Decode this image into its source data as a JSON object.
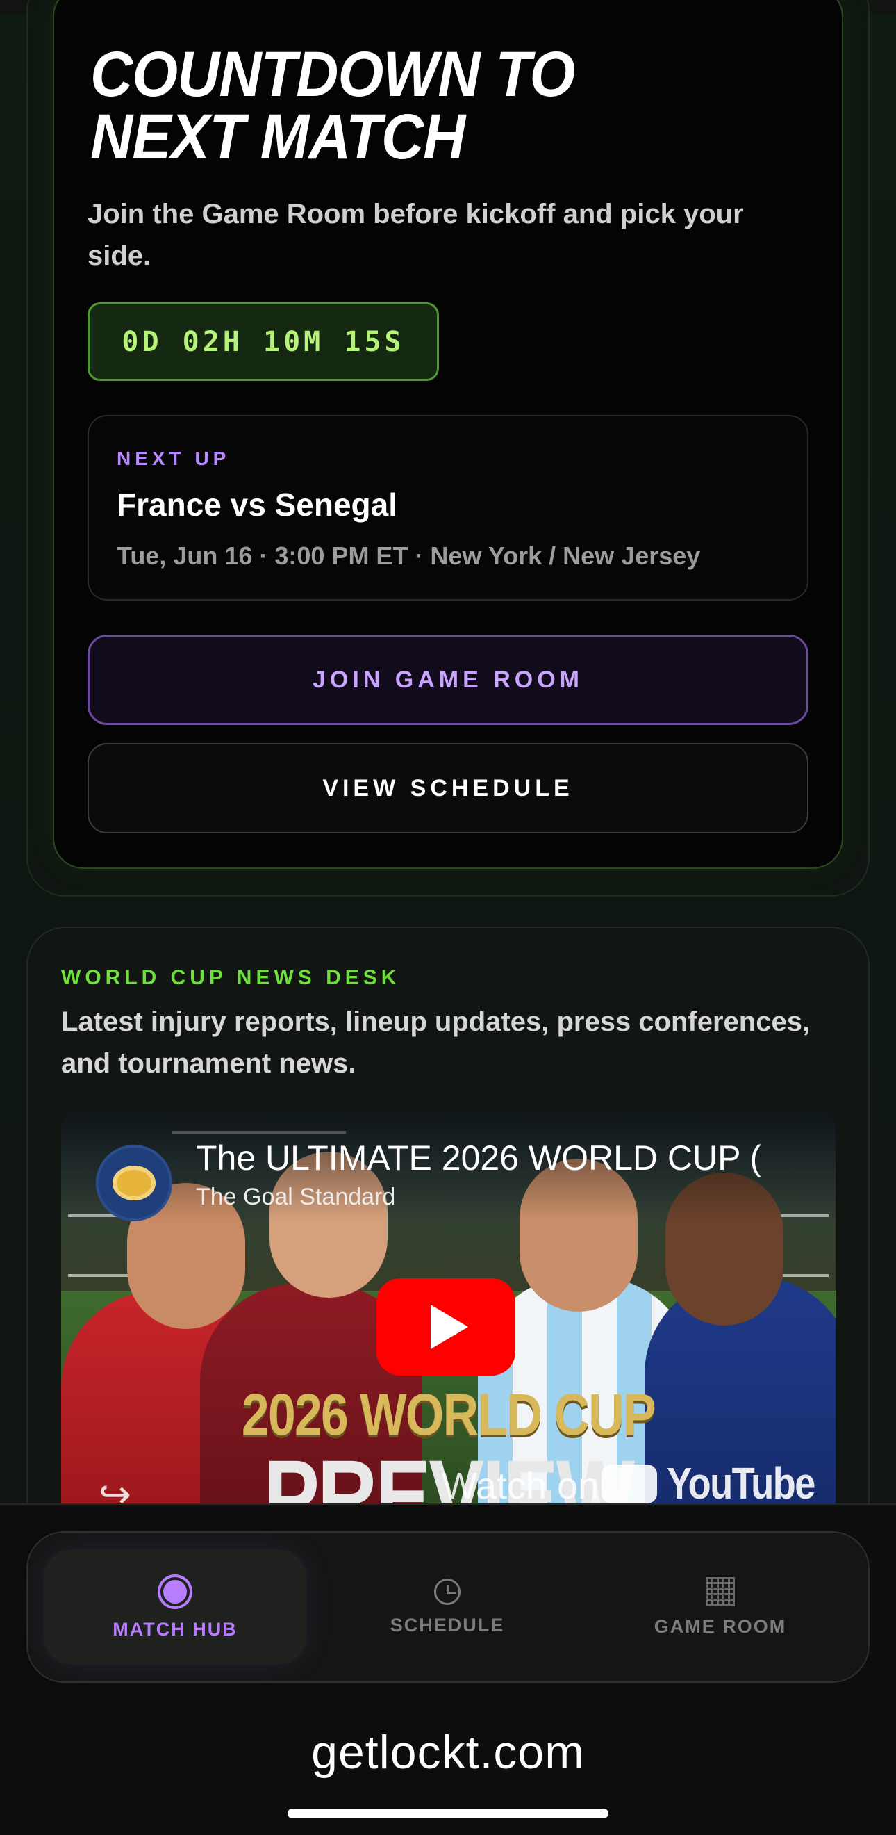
{
  "countdown": {
    "title": "COUNTDOWN TO NEXT MATCH",
    "subtitle": "Join the Game Room before kickoff and pick your side.",
    "timer": "0D 02H 10M 15S"
  },
  "next_up": {
    "label": "NEXT UP",
    "match": "France vs Senegal",
    "meta": "Tue, Jun 16 · 3:00 PM ET · New York / New Jersey"
  },
  "buttons": {
    "join": "JOIN GAME ROOM",
    "schedule": "VIEW SCHEDULE"
  },
  "news": {
    "label": "WORLD CUP NEWS DESK",
    "subtitle": "Latest injury reports, lineup updates, press conferences, and tournament news."
  },
  "video": {
    "title": "The ULTIMATE 2026 WORLD CUP (",
    "channel": "The Goal Standard",
    "thumb_line1": "2026 WORLD CUP",
    "thumb_line2": "PREVIEW",
    "watch_on": "Watch on",
    "youtube": "YouTube"
  },
  "tabs": [
    {
      "label": "MATCH HUB",
      "icon": "match-hub-icon",
      "active": true
    },
    {
      "label": "SCHEDULE",
      "icon": "clock-icon",
      "active": false
    },
    {
      "label": "GAME ROOM",
      "icon": "grid-icon",
      "active": false
    }
  ],
  "browser": {
    "domain": "getlockt.com"
  },
  "colors": {
    "accent_green": "#6ee03a",
    "accent_purple": "#b87dff",
    "timer_text": "#b7f27a",
    "youtube_red": "#ff0000"
  }
}
